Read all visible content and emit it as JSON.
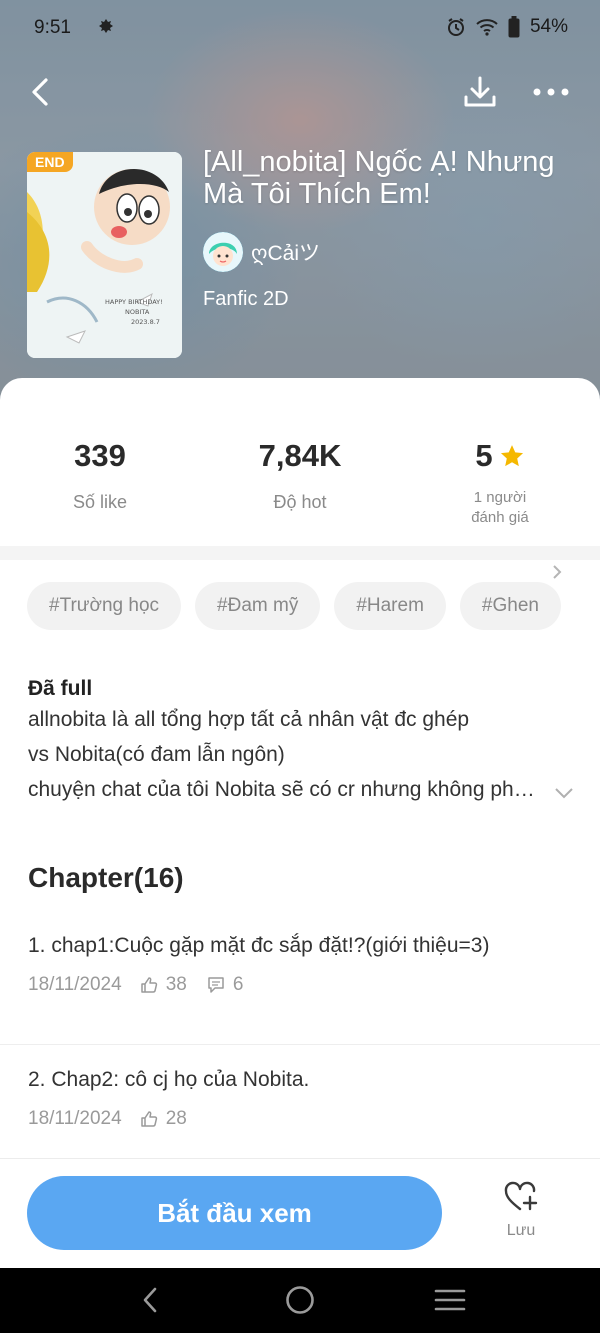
{
  "status_bar": {
    "time": "9:51",
    "battery": "54%"
  },
  "header": {
    "title": "[All_nobita] Ngốc Ạ! Nhưng Mà Tôi Thích Em!",
    "badge": "END",
    "author": "ღCảiツ",
    "genre": "Fanfic 2D",
    "cover_text_1": "HAPPY BIRTHDAY!",
    "cover_text_2": "NOBITA",
    "cover_text_3": "2023.8.7"
  },
  "stats": [
    {
      "value": "339",
      "label": "Số like"
    },
    {
      "value": "7,84K",
      "label": "Độ hot"
    },
    {
      "value": "5",
      "label_line1": "1 người",
      "label_line2": "đánh giá"
    }
  ],
  "tags": [
    "#Trường học",
    "#Đam mỹ",
    "#Harem",
    "#Ghen"
  ],
  "description": {
    "status": "Đã full",
    "line1": "allnobita là all tổng hợp tất cả nhân vật đc ghép",
    "line2": "vs Nobita(có đam lẫn ngôn)",
    "line3": "chuyện chat của tôi Nobita sẽ có cr nhưng không phải ai cũng biết"
  },
  "chapters": {
    "heading": "Chapter(16)",
    "items": [
      {
        "name": "1. chap1:Cuộc gặp mặt đc sắp đặt!?(giới thiệu=3)",
        "date": "18/11/2024",
        "likes": "38",
        "comments": "6"
      },
      {
        "name": "2. Chap2: cô cj họ của Nobita.",
        "date": "18/11/2024",
        "likes": "28"
      }
    ]
  },
  "bottom_bar": {
    "start_label": "Bắt đầu xem",
    "save_label": "Lưu"
  },
  "colors": {
    "accent": "#5aa7f2",
    "badge": "#f5a623",
    "star": "#f5b800"
  },
  "icons": [
    "back-arrow-icon",
    "download-icon",
    "more-icon",
    "star-icon",
    "chevron-right-icon",
    "chevron-down-icon",
    "thumbs-up-icon",
    "comment-icon",
    "heart-plus-icon"
  ]
}
